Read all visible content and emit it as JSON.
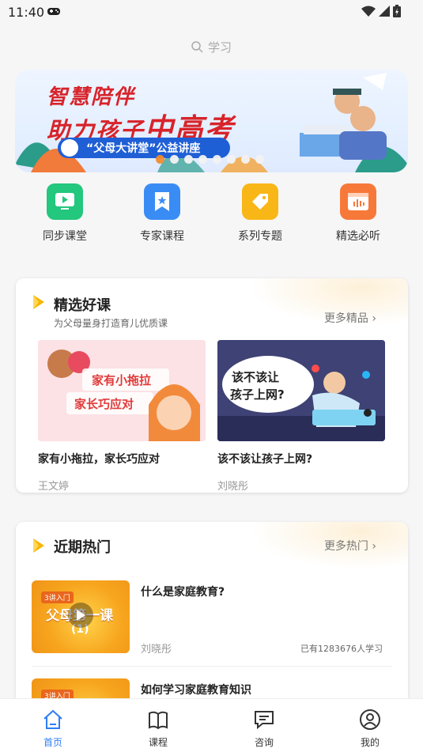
{
  "status": {
    "time": "11:40"
  },
  "search": {
    "placeholder": "学习"
  },
  "banner": {
    "line1": "智慧陪伴",
    "line2_a": "助力孩子",
    "line2_b": "中高考",
    "pill": "“父母大讲堂”公益讲座"
  },
  "quick": [
    {
      "label": "同步课堂",
      "icon": "play-screen-icon",
      "color": "#23c77d"
    },
    {
      "label": "专家课程",
      "icon": "bookmark-star-icon",
      "color": "#3a8cf5"
    },
    {
      "label": "系列专题",
      "icon": "tag-icon",
      "color": "#f9b617"
    },
    {
      "label": "精选必听",
      "icon": "audio-wave-icon",
      "color": "#f7793a"
    }
  ],
  "featured": {
    "title": "精选好课",
    "subtitle": "为父母量身打造育儿优质课",
    "more": "更多精品",
    "courses": [
      {
        "name": "家有小拖拉，家长巧应对",
        "author": "王文婷",
        "thumb_text1": "家有小拖拉",
        "thumb_text2": "家长巧应对"
      },
      {
        "name": "该不该让孩子上网?",
        "author": "刘晓彤",
        "thumb_text1": "该不该让",
        "thumb_text2": "孩子上网?"
      }
    ]
  },
  "hot": {
    "title": "近期热门",
    "more": "更多热门",
    "items": [
      {
        "title": "什么是家庭教育?",
        "author": "刘晓彤",
        "count": "已有1283676人学习",
        "badge": "3讲入门",
        "thumb_text": "父母第一课",
        "thumb_num": "(1)"
      },
      {
        "title": "如何学习家庭教育知识",
        "badge": "3讲入门"
      }
    ]
  },
  "tabs": [
    {
      "label": "首页",
      "icon": "home-icon",
      "active": true
    },
    {
      "label": "课程",
      "icon": "book-icon",
      "active": false
    },
    {
      "label": "咨询",
      "icon": "chat-icon",
      "active": false
    },
    {
      "label": "我的",
      "icon": "profile-icon",
      "active": false
    }
  ],
  "colors": {
    "accent": "#2e7df7",
    "title_red": "#d8232a",
    "dot_active": "#f28b2e"
  }
}
